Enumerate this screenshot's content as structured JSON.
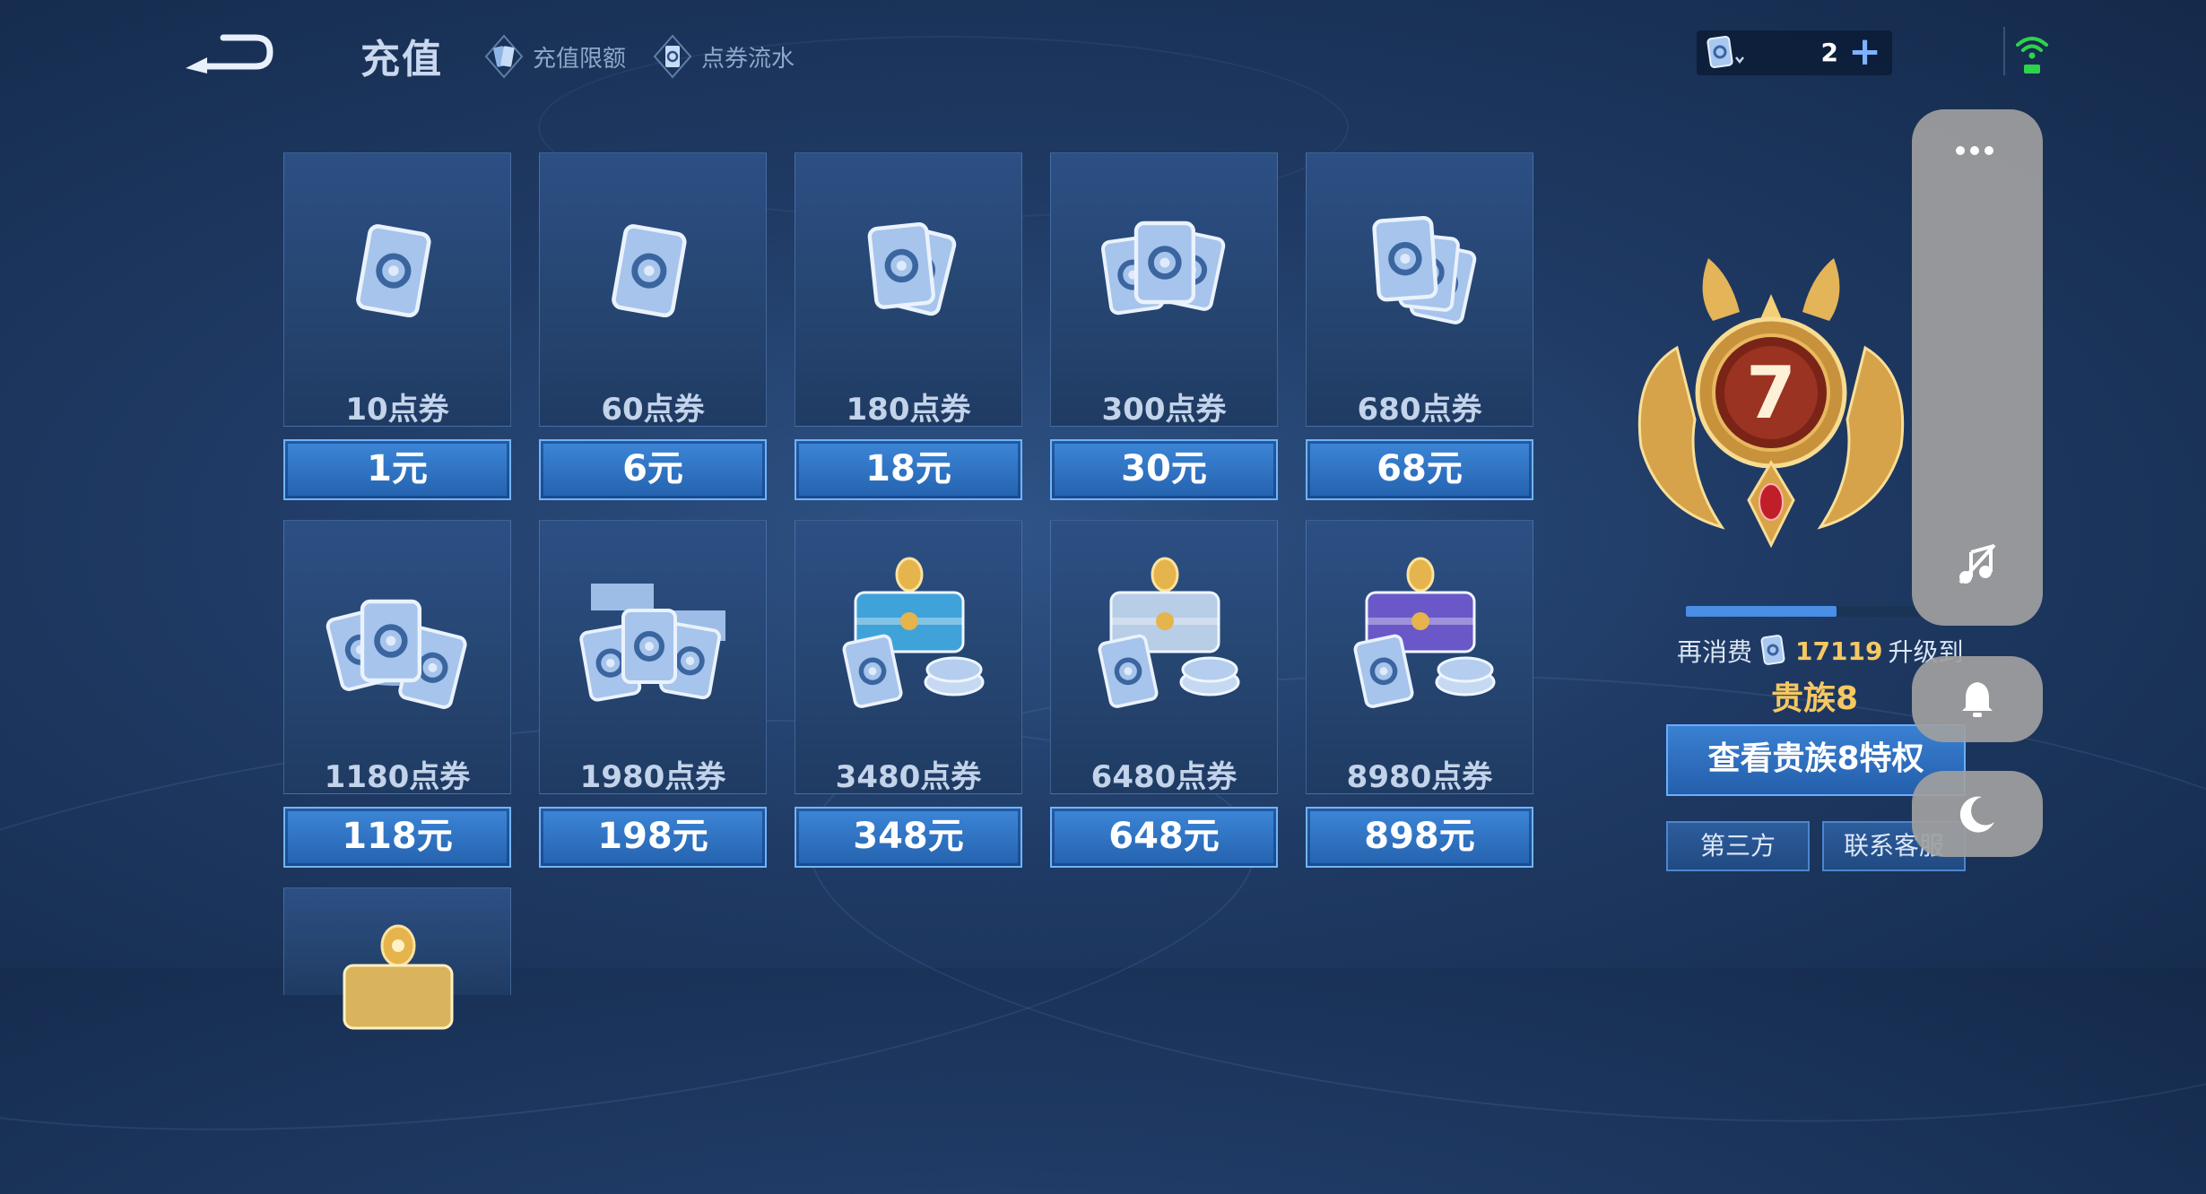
{
  "header": {
    "title": "充值",
    "links": [
      {
        "label": "充值限额",
        "icon": "card-limit-icon"
      },
      {
        "label": "点券流水",
        "icon": "coupon-flow-icon"
      }
    ],
    "balance": {
      "value": "2",
      "plus": "+"
    }
  },
  "packs": [
    {
      "amount": "10点券",
      "price": "1元",
      "art": "single-card"
    },
    {
      "amount": "60点券",
      "price": "6元",
      "art": "single-card"
    },
    {
      "amount": "180点券",
      "price": "18元",
      "art": "two-cards"
    },
    {
      "amount": "300点券",
      "price": "30元",
      "art": "three-cards"
    },
    {
      "amount": "680点券",
      "price": "68元",
      "art": "card-stack"
    },
    {
      "amount": "1180点券",
      "price": "118元",
      "art": "card-pile"
    },
    {
      "amount": "1980点券",
      "price": "198元",
      "art": "card-piles"
    },
    {
      "amount": "3480点券",
      "price": "348元",
      "art": "blue-chest"
    },
    {
      "amount": "6480点券",
      "price": "648元",
      "art": "silver-chest"
    },
    {
      "amount": "8980点券",
      "price": "898元",
      "art": "purple-chest"
    }
  ],
  "noble": {
    "level": "7",
    "progress_fraction": 0.6,
    "spend_prefix": "再消费",
    "spend_amount": "17119",
    "spend_suffix": "升级到",
    "next_level": "贵族8",
    "view_button": "查看贵族8特权",
    "third_party": "第三方",
    "contact": "联系客服"
  },
  "colors": {
    "accent": "#3d86d8",
    "gold": "#f5c862",
    "background": "#1f3a64"
  }
}
